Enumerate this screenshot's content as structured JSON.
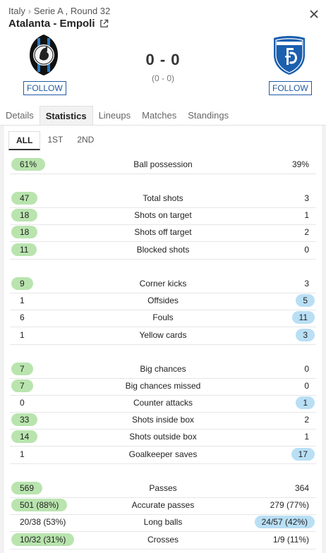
{
  "breadcrumb": {
    "country": "Italy",
    "separator": "›",
    "competition": "Serie A , Round 32"
  },
  "match": {
    "title": "Atalanta - Empoli",
    "score": "0 - 0",
    "ht_score": "(0 - 0)"
  },
  "home": {
    "follow_label": "FOLLOW"
  },
  "away": {
    "follow_label": "FOLLOW"
  },
  "tabs": [
    "Details",
    "Statistics",
    "Lineups",
    "Matches",
    "Standings"
  ],
  "active_tab": "Statistics",
  "periods": [
    "ALL",
    "1ST",
    "2ND"
  ],
  "colors": {
    "home_pill": "#b9e4ae",
    "away_pill": "#b9dff5",
    "follow_blue": "#1f5aa6"
  },
  "stats": [
    {
      "label": "Ball possession",
      "home": "61%",
      "away": "39%",
      "leader": "home"
    },
    {
      "label": "Total shots",
      "home": "47",
      "away": "3",
      "leader": "home"
    },
    {
      "label": "Shots on target",
      "home": "18",
      "away": "1",
      "leader": "home"
    },
    {
      "label": "Shots off target",
      "home": "18",
      "away": "2",
      "leader": "home"
    },
    {
      "label": "Blocked shots",
      "home": "11",
      "away": "0",
      "leader": "home"
    },
    {
      "label": "Corner kicks",
      "home": "9",
      "away": "3",
      "leader": "home"
    },
    {
      "label": "Offsides",
      "home": "1",
      "away": "5",
      "leader": "away"
    },
    {
      "label": "Fouls",
      "home": "6",
      "away": "11",
      "leader": "away"
    },
    {
      "label": "Yellow cards",
      "home": "1",
      "away": "3",
      "leader": "away"
    },
    {
      "label": "Big chances",
      "home": "7",
      "away": "0",
      "leader": "home"
    },
    {
      "label": "Big chances missed",
      "home": "7",
      "away": "0",
      "leader": "home"
    },
    {
      "label": "Counter attacks",
      "home": "0",
      "away": "1",
      "leader": "away"
    },
    {
      "label": "Shots inside box",
      "home": "33",
      "away": "2",
      "leader": "home"
    },
    {
      "label": "Shots outside box",
      "home": "14",
      "away": "1",
      "leader": "home"
    },
    {
      "label": "Goalkeeper saves",
      "home": "1",
      "away": "17",
      "leader": "away"
    },
    {
      "label": "Passes",
      "home": "569",
      "away": "364",
      "leader": "home"
    },
    {
      "label": "Accurate passes",
      "home": "501 (88%)",
      "away": "279 (77%)",
      "leader": "home"
    },
    {
      "label": "Long balls",
      "home": "20/38 (53%)",
      "away": "24/57 (42%)",
      "leader": "away"
    },
    {
      "label": "Crosses",
      "home": "10/32 (31%)",
      "away": "1/9 (11%)",
      "leader": "home"
    }
  ]
}
